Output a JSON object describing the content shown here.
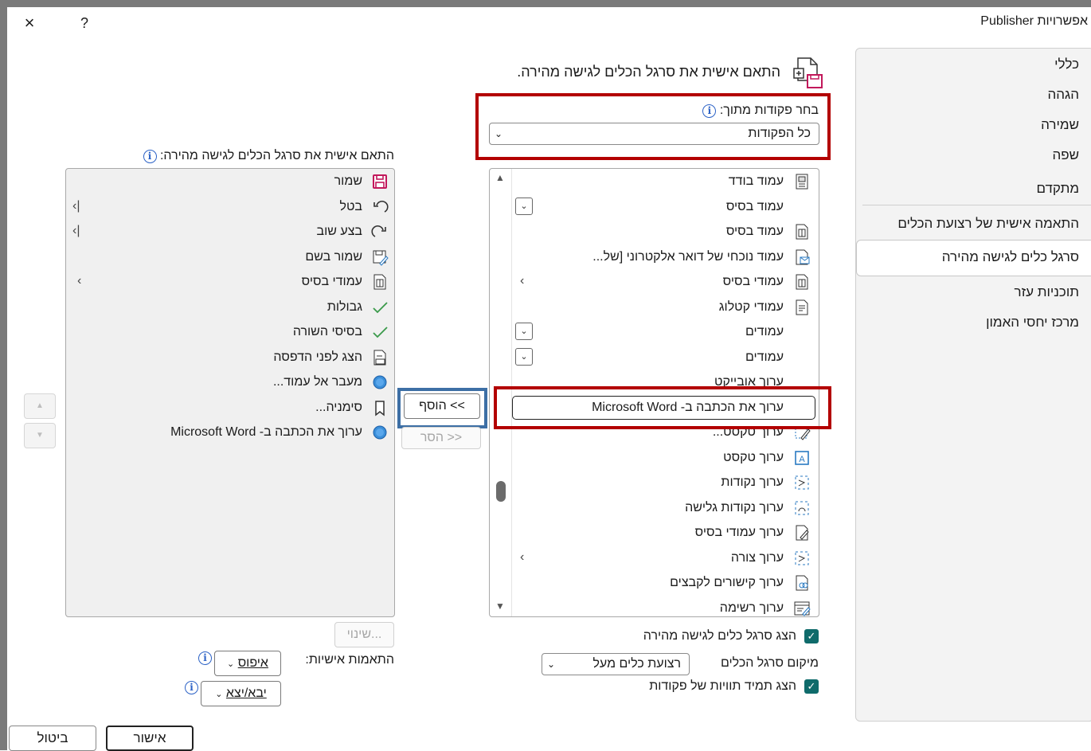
{
  "window": {
    "title": "אפשרויות Publisher",
    "close_icon": "×",
    "help_icon": "?"
  },
  "nav": {
    "items": [
      {
        "label": "כללי"
      },
      {
        "label": "הגהה"
      },
      {
        "label": "שמירה"
      },
      {
        "label": "שפה"
      },
      {
        "label": "מתקדם"
      },
      {
        "label": "התאמה אישית של רצועת הכלים"
      },
      {
        "label": "סרגל כלים לגישה מהירה",
        "selected": true
      },
      {
        "label": "תוכניות עזר"
      },
      {
        "label": "מרכז יחסי האמון"
      }
    ]
  },
  "header": {
    "text": "התאם אישית את סרגל הכלים לגישה מהירה."
  },
  "choose": {
    "label": "בחר פקודות מתוך:",
    "value": "כל הפקודות"
  },
  "customize": {
    "label": "התאם אישית את סרגל הכלים לגישה מהירה:"
  },
  "commands": [
    {
      "label": "עמוד בודד",
      "icon": "page-icon"
    },
    {
      "label": "עמוד בסיס",
      "icon": "",
      "dropdown": true
    },
    {
      "label": "עמוד בסיס",
      "icon": "master-page-icon"
    },
    {
      "label": "עמוד נוכחי של דואר אלקטרוני [של...",
      "icon": "email-page-icon"
    },
    {
      "label": "עמודי בסיס",
      "icon": "master-pages-icon",
      "submenu": true
    },
    {
      "label": "עמודי קטלוג",
      "icon": "catalog-pages-icon"
    },
    {
      "label": "עמודים",
      "icon": "",
      "dropdown": true
    },
    {
      "label": "עמודים",
      "icon": "",
      "dropdown": true
    },
    {
      "label": "ערוך אובייקט",
      "icon": ""
    },
    {
      "label": "ערוך את הכתבה ב- Microsoft Word",
      "icon": "",
      "selected": true
    },
    {
      "label": "ערוך טקסט...",
      "icon": "edit-text-icon"
    },
    {
      "label": "ערוך טקסט",
      "icon": "text-box-icon"
    },
    {
      "label": "ערוך נקודות",
      "icon": "edit-points-icon"
    },
    {
      "label": "ערוך נקודות גלישה",
      "icon": "wrap-points-icon"
    },
    {
      "label": "ערוך עמודי בסיס",
      "icon": "edit-master-icon"
    },
    {
      "label": "ערוך צורה",
      "icon": "edit-shape-icon",
      "submenu": true
    },
    {
      "label": "ערוך קישורים לקבצים",
      "icon": "file-links-icon"
    },
    {
      "label": "ערוך רשימה",
      "icon": "edit-list-icon"
    }
  ],
  "toolbar_items": [
    {
      "label": "שמור",
      "icon": "save-icon"
    },
    {
      "label": "בטל",
      "icon": "undo-icon",
      "split": true
    },
    {
      "label": "בצע שוב",
      "icon": "redo-icon",
      "split": true
    },
    {
      "label": "שמור בשם",
      "icon": "save-as-icon"
    },
    {
      "label": "עמודי בסיס",
      "icon": "master-pages-icon",
      "submenu": true
    },
    {
      "label": "גבולות",
      "icon": "check-icon"
    },
    {
      "label": "בסיסי השורה",
      "icon": "check-icon"
    },
    {
      "label": "הצג לפני הדפסה",
      "icon": "print-preview-icon"
    },
    {
      "label": "מעבר אל עמוד...",
      "icon": "goto-page-icon"
    },
    {
      "label": "סימניה...",
      "icon": "bookmark-icon"
    },
    {
      "label": "ערוך את הכתבה ב- Microsoft Word",
      "icon": "word-edit-icon"
    }
  ],
  "buttons": {
    "add": "הוסף <<",
    "remove": "הסר >>",
    "modify": "שינוי...",
    "reset": "איפוס",
    "import_export": "יבא/יצא",
    "ok": "אישור",
    "cancel": "ביטול"
  },
  "customizations_label": "התאמות אישיות:",
  "options": {
    "show_qat": "הצג סרגל כלים לגישה מהירה",
    "location_label": "מיקום סרגל הכלים",
    "location_value": "רצועת כלים מעל",
    "always_show_labels": "הצג תמיד תוויות של פקודות"
  },
  "colors": {
    "highlight_red": "#b30000",
    "highlight_blue": "#3d6fa5",
    "checkbox": "#0f6b6b",
    "nav_bg": "#f3f3f3"
  }
}
